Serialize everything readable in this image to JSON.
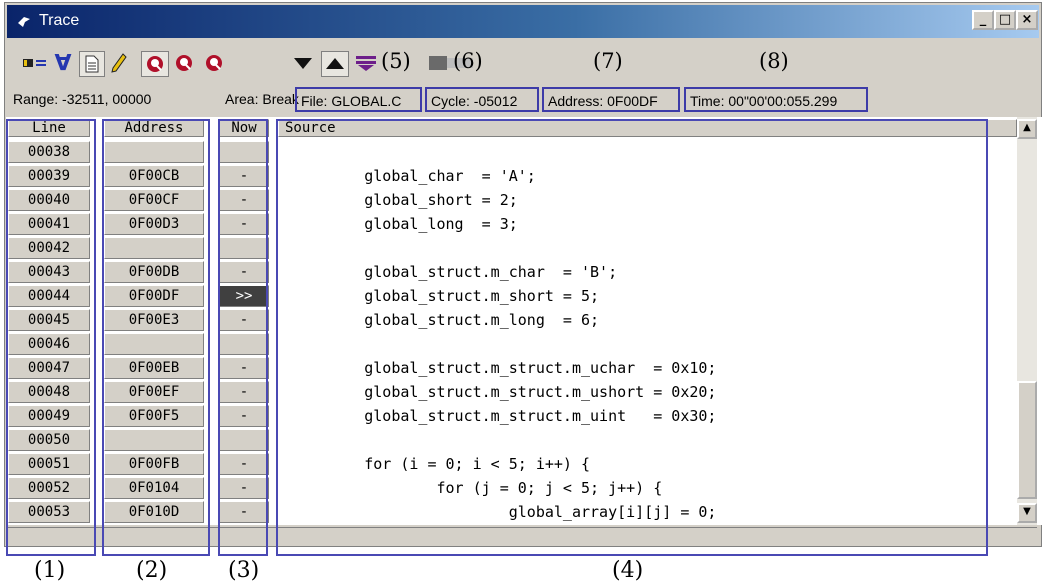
{
  "window": {
    "title": "Trace",
    "controls": {
      "minimize": "_",
      "maximize": "□",
      "close": "×"
    }
  },
  "toolbar": {
    "icons": [
      "trace-settings-icon",
      "filter-icon",
      "view-source-icon",
      "edit-icon",
      "search-icon",
      "search-forward-icon",
      "search-backward-icon",
      "step-down-icon",
      "step-up-icon",
      "select-icon",
      "clear-icon"
    ],
    "annotations": {
      "a5": "(5)",
      "a6": "(6)",
      "a7": "(7)",
      "a8": "(8)"
    }
  },
  "status": {
    "range": "Range: -32511,  00000",
    "area": "Area: Break",
    "file": "File: GLOBAL.C",
    "cycle": "Cycle: -05012",
    "address": "Address: 0F00DF",
    "time": "Time: 00\"00'00:055.299"
  },
  "columns": {
    "line": "Line",
    "address": "Address",
    "now": "Now",
    "source": "Source"
  },
  "rows": [
    {
      "line": "00038",
      "address": "",
      "now": "",
      "source": ""
    },
    {
      "line": "00039",
      "address": "0F00CB",
      "now": "-",
      "source": "        global_char  = 'A';"
    },
    {
      "line": "00040",
      "address": "0F00CF",
      "now": "-",
      "source": "        global_short = 2;"
    },
    {
      "line": "00041",
      "address": "0F00D3",
      "now": "-",
      "source": "        global_long  = 3;"
    },
    {
      "line": "00042",
      "address": "",
      "now": "",
      "source": ""
    },
    {
      "line": "00043",
      "address": "0F00DB",
      "now": "-",
      "source": "        global_struct.m_char  = 'B';"
    },
    {
      "line": "00044",
      "address": "0F00DF",
      "now": ">>",
      "source": "        global_struct.m_short = 5;"
    },
    {
      "line": "00045",
      "address": "0F00E3",
      "now": "-",
      "source": "        global_struct.m_long  = 6;"
    },
    {
      "line": "00046",
      "address": "",
      "now": "",
      "source": ""
    },
    {
      "line": "00047",
      "address": "0F00EB",
      "now": "-",
      "source": "        global_struct.m_struct.m_uchar  = 0x10;"
    },
    {
      "line": "00048",
      "address": "0F00EF",
      "now": "-",
      "source": "        global_struct.m_struct.m_ushort = 0x20;"
    },
    {
      "line": "00049",
      "address": "0F00F5",
      "now": "-",
      "source": "        global_struct.m_struct.m_uint   = 0x30;"
    },
    {
      "line": "00050",
      "address": "",
      "now": "",
      "source": ""
    },
    {
      "line": "00051",
      "address": "0F00FB",
      "now": "-",
      "source": "        for (i = 0; i < 5; i++) {"
    },
    {
      "line": "00052",
      "address": "0F0104",
      "now": "-",
      "source": "                for (j = 0; j < 5; j++) {"
    },
    {
      "line": "00053",
      "address": "0F010D",
      "now": "-",
      "source": "                        global_array[i][j] = 0;"
    }
  ],
  "annotations": {
    "a1": "(1)",
    "a2": "(2)",
    "a3": "(3)",
    "a4": "(4)"
  },
  "colors": {
    "titlebar_start": "#0a246a",
    "titlebar_end": "#a6caf0",
    "annotation_box": "#4a49b4",
    "window_bg": "#d4d0c8"
  }
}
